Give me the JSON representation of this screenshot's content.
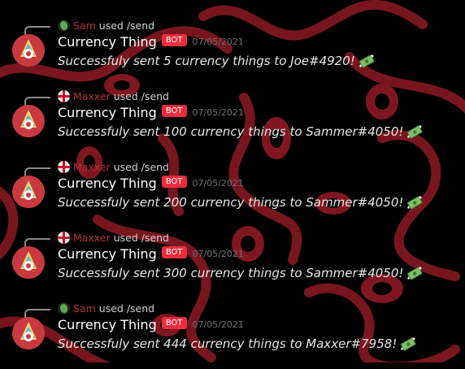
{
  "messages": [
    {
      "reply_user": "Sam",
      "reply_avatar": "green-avatar",
      "reply_command": "used /send",
      "author": "Currency Thing",
      "bot_tag": "BOT",
      "timestamp": "07/05/2021",
      "content": "Successfuly sent 5 currency things to Joe#4920!",
      "emoji": "money-with-wings-icon"
    },
    {
      "reply_user": "Maxxer",
      "reply_avatar": "flag-avatar",
      "reply_command": "used /send",
      "author": "Currency Thing",
      "bot_tag": "BOT",
      "timestamp": "07/05/2021",
      "content": "Successfuly sent 100 currency things to Sammer#4050!",
      "emoji": "money-with-wings-icon"
    },
    {
      "reply_user": "Maxxer",
      "reply_avatar": "flag-avatar",
      "reply_command": "used /send",
      "author": "Currency Thing",
      "bot_tag": "BOT",
      "timestamp": "07/05/2021",
      "content": "Successfuly sent 200 currency things to Sammer#4050!",
      "emoji": "money-with-wings-icon"
    },
    {
      "reply_user": "Maxxer",
      "reply_avatar": "flag-avatar",
      "reply_command": "used /send",
      "author": "Currency Thing",
      "bot_tag": "BOT",
      "timestamp": "07/05/2021",
      "content": "Successfuly sent 300 currency things to Sammer#4050!",
      "emoji": "money-with-wings-icon"
    },
    {
      "reply_user": "Sam",
      "reply_avatar": "green-avatar",
      "reply_command": "used /send",
      "author": "Currency Thing",
      "bot_tag": "BOT",
      "timestamp": "07/05/2021",
      "content": "Successfuly sent 444 currency things to Maxxer#7958!",
      "emoji": "money-with-wings-icon"
    }
  ],
  "colors": {
    "background": "#000000",
    "pattern": "#8e1a24",
    "bot_tag": "#ed2c3e",
    "reply_user": "#b3343c",
    "timestamp": "#6f7176"
  }
}
